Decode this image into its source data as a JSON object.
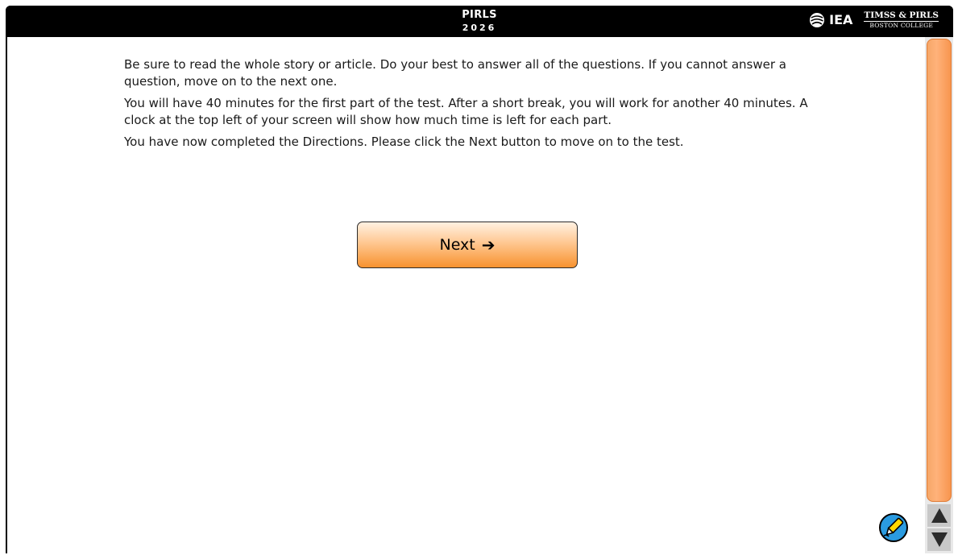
{
  "header": {
    "title": "PIRLS",
    "year": "2026",
    "iea_label": "IEA",
    "partner_line1": "TIMSS & PIRLS",
    "partner_line2": "BOSTON COLLEGE"
  },
  "instructions": {
    "paragraph1": "Be sure to read the whole story or article. Do your best to answer all of the questions. If you cannot answer a question, move on to the next one.",
    "paragraph2": "You will have 40 minutes for the first part of the test. After a short break, you will work for another 40 minutes. A clock at the top left of your screen will show how much time is left for each part.",
    "paragraph3": "You have now completed the Directions. Please click the Next button to move on to the test."
  },
  "next_button": {
    "label": "Next",
    "arrow": "➔"
  },
  "icons": {
    "logo": "globe-icon",
    "highlighter": "highlighter-pen-icon",
    "scroll_up": "triangle-up-icon",
    "scroll_down": "triangle-down-icon"
  },
  "colors": {
    "accent_orange": "#f7922f",
    "topbar": "#000000",
    "highlighter_blue": "#2a9be0",
    "highlighter_yellow": "#ffd800"
  }
}
